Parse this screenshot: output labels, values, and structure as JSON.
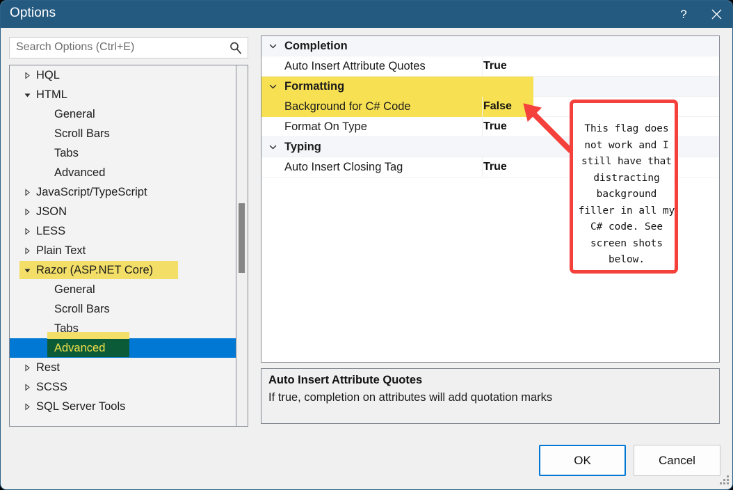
{
  "window": {
    "title": "Options",
    "help_icon": "question-mark-icon",
    "close_icon": "close-icon"
  },
  "search": {
    "placeholder": "Search Options (Ctrl+E)",
    "value": "",
    "icon": "search-icon"
  },
  "tree": {
    "items": [
      {
        "label": "HQL",
        "indent": 0,
        "twisty": "collapsed",
        "state": "normal"
      },
      {
        "label": "HTML",
        "indent": 0,
        "twisty": "expanded",
        "state": "normal"
      },
      {
        "label": "General",
        "indent": 1,
        "twisty": "none",
        "state": "normal"
      },
      {
        "label": "Scroll Bars",
        "indent": 1,
        "twisty": "none",
        "state": "normal"
      },
      {
        "label": "Tabs",
        "indent": 1,
        "twisty": "none",
        "state": "normal"
      },
      {
        "label": "Advanced",
        "indent": 1,
        "twisty": "none",
        "state": "normal"
      },
      {
        "label": "JavaScript/TypeScript",
        "indent": 0,
        "twisty": "collapsed",
        "state": "normal"
      },
      {
        "label": "JSON",
        "indent": 0,
        "twisty": "collapsed",
        "state": "normal"
      },
      {
        "label": "LESS",
        "indent": 0,
        "twisty": "collapsed",
        "state": "normal"
      },
      {
        "label": "Plain Text",
        "indent": 0,
        "twisty": "collapsed",
        "state": "normal"
      },
      {
        "label": "Razor (ASP.NET Core)",
        "indent": 0,
        "twisty": "expanded",
        "state": "highlighted"
      },
      {
        "label": "General",
        "indent": 1,
        "twisty": "none",
        "state": "normal"
      },
      {
        "label": "Scroll Bars",
        "indent": 1,
        "twisty": "none",
        "state": "normal"
      },
      {
        "label": "Tabs",
        "indent": 1,
        "twisty": "none",
        "state": "normal"
      },
      {
        "label": "Advanced",
        "indent": 1,
        "twisty": "none",
        "state": "selected-highlighted"
      },
      {
        "label": "Rest",
        "indent": 0,
        "twisty": "collapsed",
        "state": "normal"
      },
      {
        "label": "SCSS",
        "indent": 0,
        "twisty": "collapsed",
        "state": "normal"
      },
      {
        "label": "SQL Server Tools",
        "indent": 0,
        "twisty": "collapsed",
        "state": "normal"
      }
    ]
  },
  "grid": {
    "rows": [
      {
        "kind": "category",
        "name": "Completion",
        "value": "",
        "twisty": "expanded",
        "highlight": false
      },
      {
        "kind": "option",
        "name": "Auto Insert Attribute Quotes",
        "value": "True",
        "twisty": "none",
        "highlight": false
      },
      {
        "kind": "category",
        "name": "Formatting",
        "value": "",
        "twisty": "expanded",
        "highlight": true
      },
      {
        "kind": "option",
        "name": "Background for C# Code",
        "value": "False",
        "twisty": "none",
        "highlight": true
      },
      {
        "kind": "option",
        "name": "Format On Type",
        "value": "True",
        "twisty": "none",
        "highlight": false
      },
      {
        "kind": "category",
        "name": "Typing",
        "value": "",
        "twisty": "expanded",
        "highlight": false
      },
      {
        "kind": "option",
        "name": "Auto Insert Closing Tag",
        "value": "True",
        "twisty": "none",
        "highlight": false
      }
    ]
  },
  "description": {
    "title": "Auto Insert Attribute Quotes",
    "body": "If true, completion on attributes will add quotation marks"
  },
  "buttons": {
    "ok": "OK",
    "cancel": "Cancel"
  },
  "annotation": {
    "text": "This flag does not work and I still have that distracting background filler in all my C# code. See screen shots below.",
    "color": "#f5413c"
  },
  "colors": {
    "titlebar": "#255a80",
    "selection": "#0078d4",
    "highlight_yellow": "#f3df68",
    "grid_highlight_yellow": "#f7e153",
    "selected_green": "#0b5b38",
    "selected_text_yellow": "#f3e14a"
  }
}
